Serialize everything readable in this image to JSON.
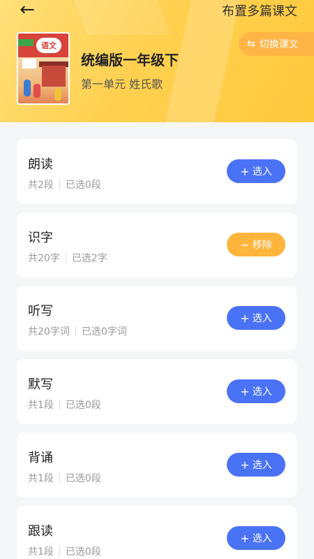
{
  "header": {
    "back_icon": "arrow-left-icon",
    "multi_lesson_label": "布置多篇课文",
    "switch_lesson_label": "切换课文",
    "switch_icon": "swap-icon",
    "book_cover_logo": "语文",
    "book_title": "统编版一年级下",
    "unit_subtitle": "第一单元 姓氏歌"
  },
  "colors": {
    "header_yellow": "#ffd050",
    "add_button_blue": "#4a72f5",
    "remove_button_orange": "#ffb43c",
    "switch_button_orange": "#ffb046"
  },
  "tasks": [
    {
      "name": "朗读",
      "total": "共2段",
      "selected": "已选0段",
      "action_label": "选入",
      "action_type": "add",
      "action_icon": "plus-icon"
    },
    {
      "name": "识字",
      "total": "共20字",
      "selected": "已选2字",
      "action_label": "移除",
      "action_type": "remove",
      "action_icon": "minus-icon"
    },
    {
      "name": "听写",
      "total": "共20字词",
      "selected": "已选0字词",
      "action_label": "选入",
      "action_type": "add",
      "action_icon": "plus-icon"
    },
    {
      "name": "默写",
      "total": "共1段",
      "selected": "已选0段",
      "action_label": "选入",
      "action_type": "add",
      "action_icon": "plus-icon"
    },
    {
      "name": "背诵",
      "total": "共1段",
      "selected": "已选0段",
      "action_label": "选入",
      "action_type": "add",
      "action_icon": "plus-icon"
    },
    {
      "name": "跟读",
      "total": "共1段",
      "selected": "已选0段",
      "action_label": "选入",
      "action_type": "add",
      "action_icon": "plus-icon"
    }
  ]
}
